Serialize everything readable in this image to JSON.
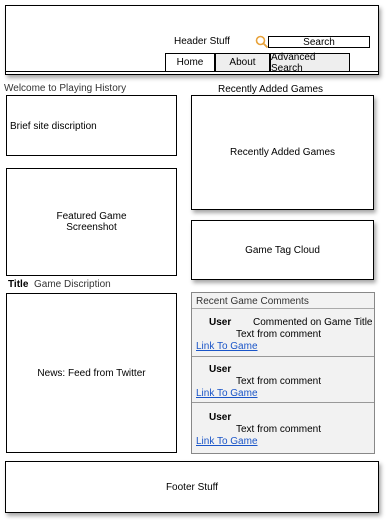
{
  "header": {
    "title": "Header Stuff",
    "search_label": "Search",
    "tabs": [
      {
        "label": "Home",
        "active": true
      },
      {
        "label": "About",
        "active": false
      },
      {
        "label": "Advanced Search",
        "active": false
      }
    ]
  },
  "welcome": "Welcome to Playing History",
  "recently_added_heading": "Recently Added Games",
  "brief": "Brief site discription",
  "recently_added_box": "Recently Added Games",
  "featured": {
    "line1": "Featured Game",
    "line2": "Screenshot"
  },
  "tag_cloud": "Game Tag Cloud",
  "title_row": {
    "label": "Title",
    "desc": "Game Discription"
  },
  "news": "News: Feed from Twitter",
  "comments": {
    "header": "Recent Game Comments",
    "items": [
      {
        "user": "User",
        "action": "Commented on Game Title",
        "text": "Text from comment",
        "link": "Link To Game"
      },
      {
        "user": "User",
        "action": "",
        "text": "Text from comment",
        "link": "Link To Game"
      },
      {
        "user": "User",
        "action": "",
        "text": "Text from comment",
        "link": "Link To Game"
      }
    ]
  },
  "footer": "Footer Stuff",
  "colors": {
    "link": "#1a55c8",
    "panel_bg": "#f2f2f2",
    "search_icon": "#e8a23a"
  }
}
